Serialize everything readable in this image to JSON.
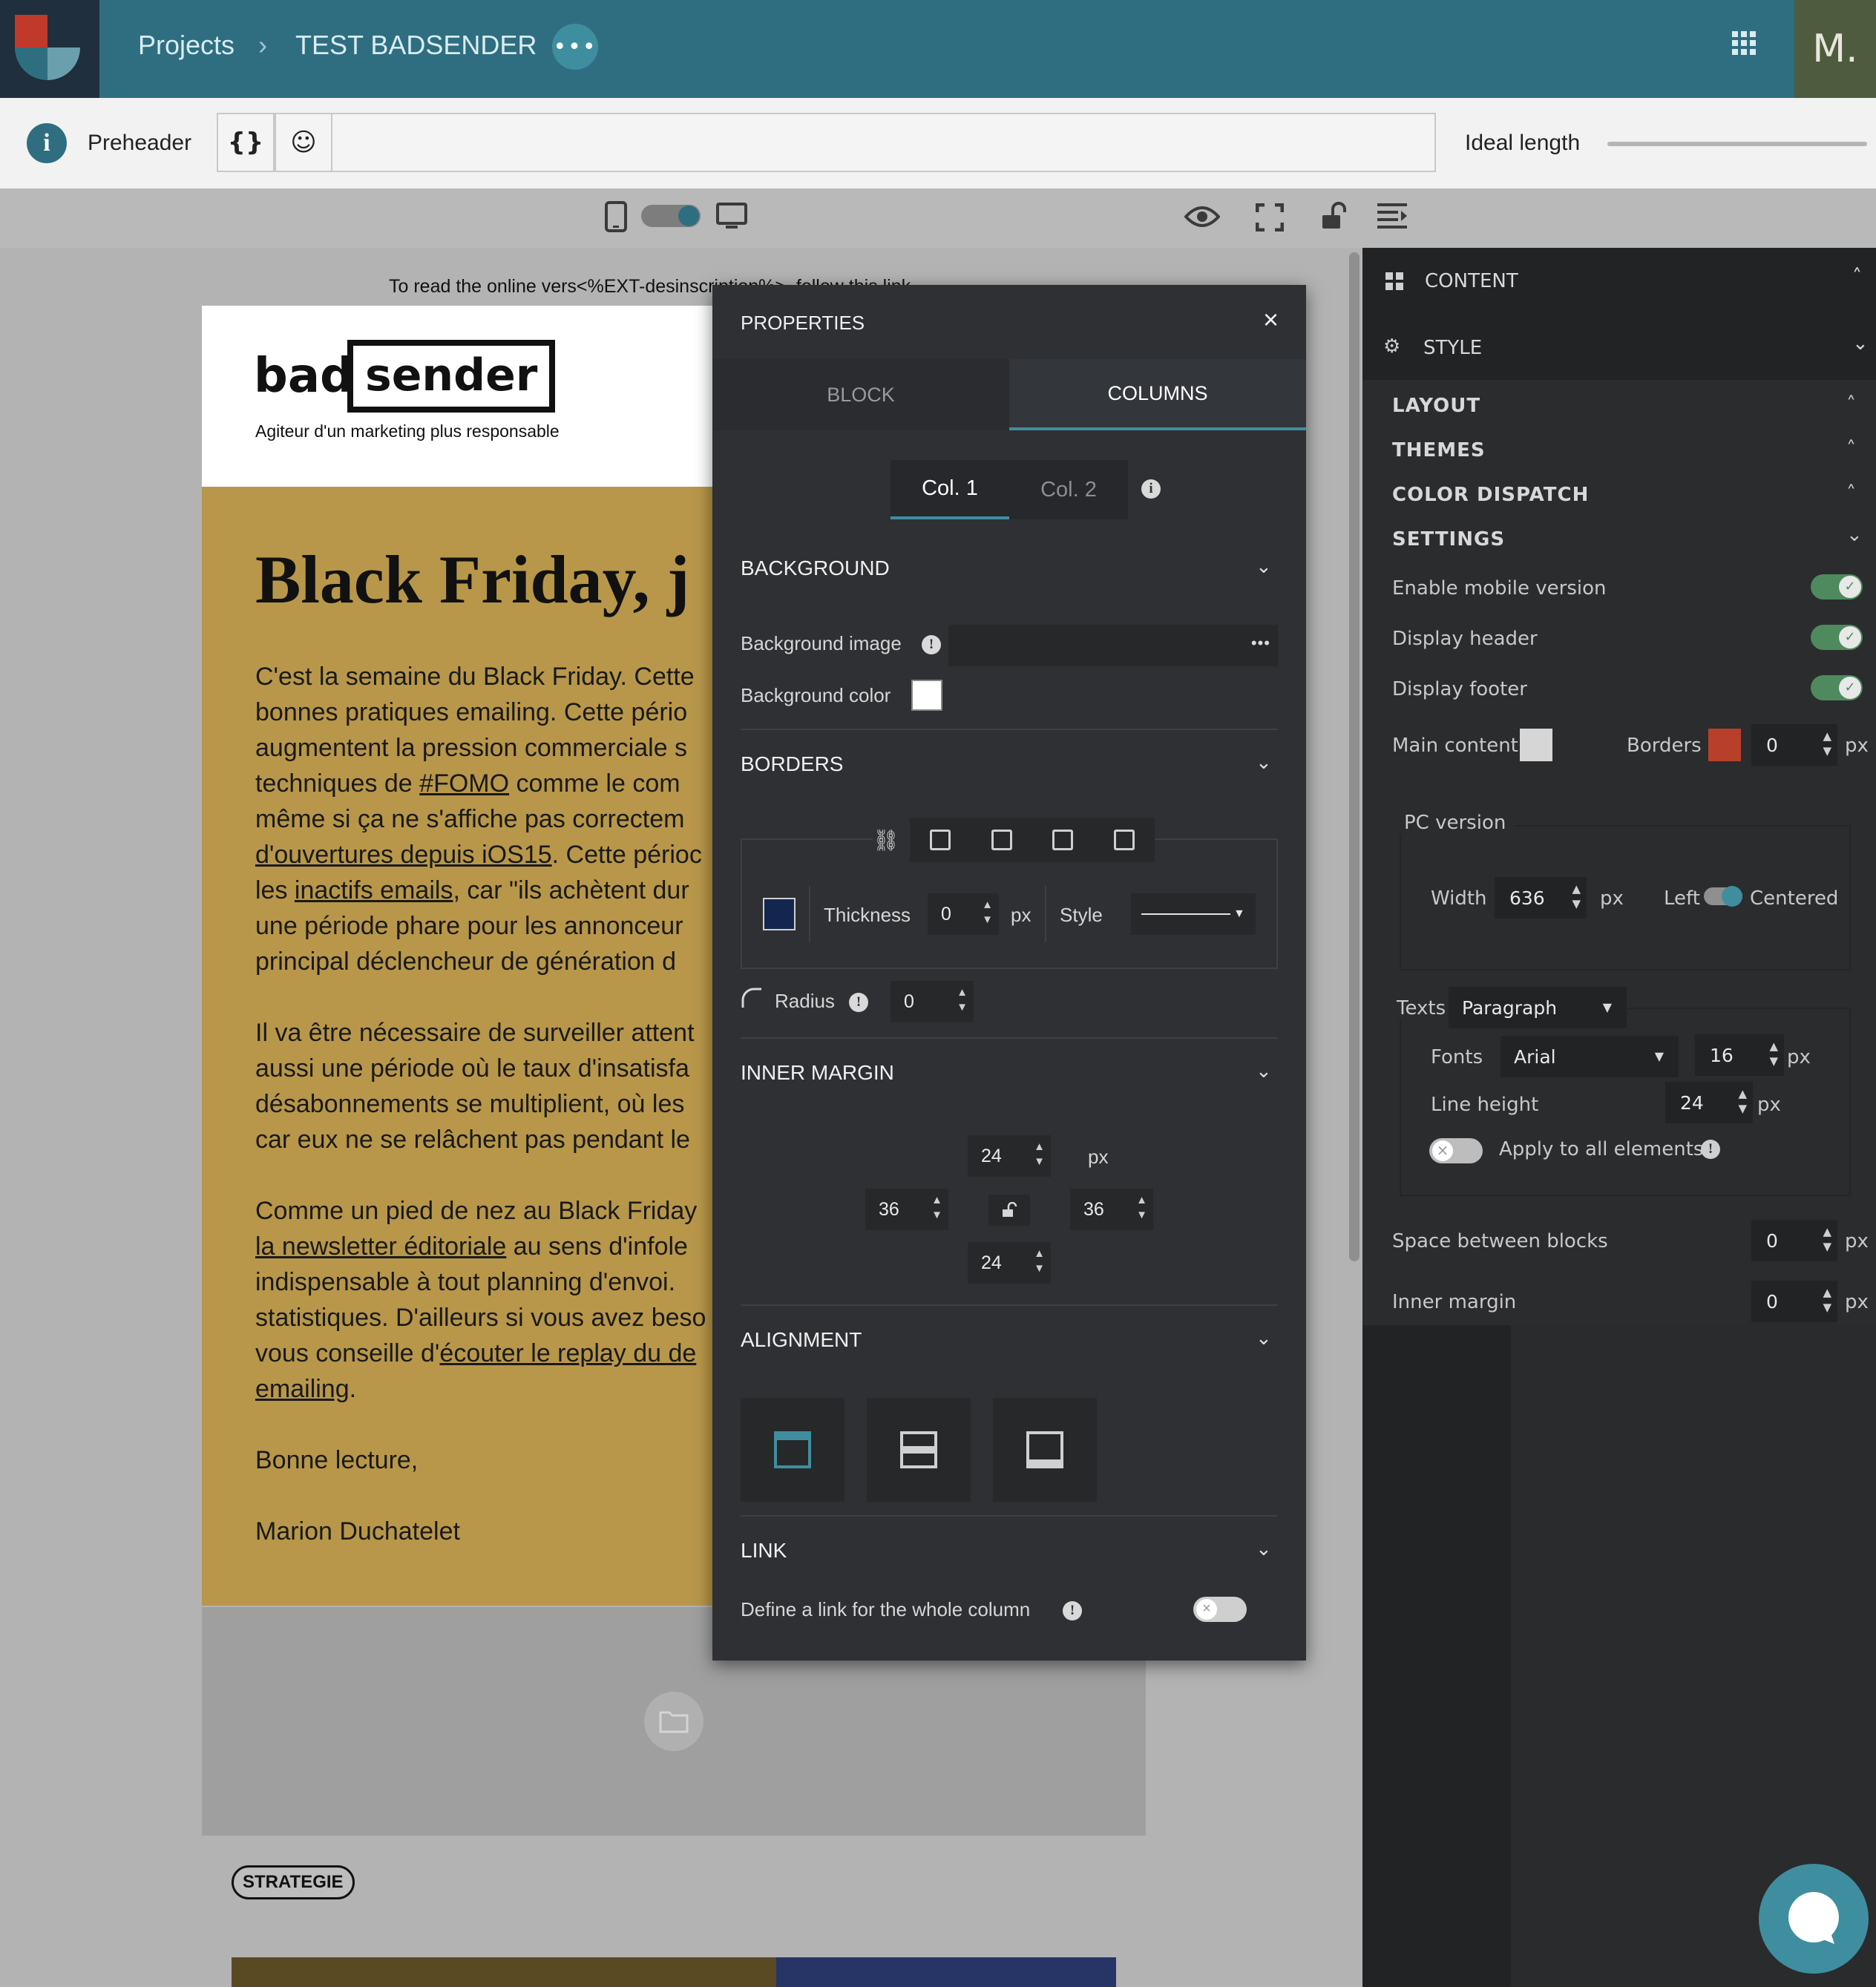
{
  "topbar": {
    "breadcrumb_projects": "Projects",
    "breadcrumb_sep": "›",
    "breadcrumb_project": "TEST BADSENDER",
    "more_label": "•••",
    "avatar": "M."
  },
  "preheader": {
    "info": "i",
    "label": "Preheader",
    "vars_button": "{}",
    "emoji_button": "☺",
    "input_value": "",
    "ideal_length_label": "Ideal length"
  },
  "email": {
    "online_text": "To read the online vers<%EXT-desinscription%>, follow this link",
    "brand_bad": "bad",
    "brand_sender": "sender",
    "tagline": "Agiteur d'un marketing plus responsable",
    "headline": "Black Friday, j",
    "p1": [
      "C'est la semaine du Black Friday. Cette",
      "bonnes pratiques emailing. Cette pério",
      "augmentent la pression commerciale s",
      "techniques de ",
      "#FOMO",
      " comme le com",
      "même si ça ne s'affiche pas correctem",
      "d'ouvertures depuis iOS15",
      ". Cette périoc",
      "les ",
      "inactifs emails",
      ", car \"ils achètent dur",
      "une période phare pour les annonceur",
      "principal déclencheur de génération d"
    ],
    "p2": [
      "Il va être nécessaire de surveiller attent",
      "aussi une période où le taux d'insatisfa",
      "désabonnements se multiplient, où les",
      "car eux ne se relâchent pas pendant le"
    ],
    "p3": [
      "Comme un pied de nez au Black Friday",
      "la newsletter éditoriale",
      " au sens d'infole",
      "indispensable à tout planning d'envoi.",
      "statistiques. D'ailleurs si vous avez beso",
      "vous conseille d'",
      "écouter le replay du de",
      "emailing",
      "."
    ],
    "closing": "Bonne lecture,",
    "signature": "Marion Duchatelet",
    "tag": "STRATEGIE"
  },
  "properties": {
    "title": "PROPERTIES",
    "close": "×",
    "tabs": [
      "BLOCK",
      "COLUMNS"
    ],
    "active_tab": "COLUMNS",
    "col_tabs": [
      "Col. 1",
      "Col. 2"
    ],
    "col_info": "i",
    "background": {
      "title": "BACKGROUND",
      "image_label": "Background image",
      "image_more": "•••",
      "color_label": "Background color"
    },
    "borders": {
      "title": "BORDERS",
      "thickness_label": "Thickness",
      "thickness_value": "0",
      "unit": "px",
      "style_label": "Style",
      "radius_label": "Radius",
      "radius_value": "0",
      "color": "#13264f"
    },
    "inner_margin": {
      "title": "INNER MARGIN",
      "top": "24",
      "left": "36",
      "right": "36",
      "bottom": "24",
      "unit": "px"
    },
    "alignment": {
      "title": "ALIGNMENT"
    },
    "link": {
      "title": "LINK",
      "label": "Define a link for the whole column"
    },
    "info_mark": "!"
  },
  "right_panel": {
    "content_label": "CONTENT",
    "style_label": "STYLE",
    "layout": "LAYOUT",
    "themes": "THEMES",
    "color_dispatch": "COLOR DISPATCH",
    "settings": "SETTINGS",
    "enable_mobile": "Enable mobile version",
    "display_header": "Display header",
    "display_footer": "Display footer",
    "main_content": "Main content",
    "borders": "Borders",
    "borders_value": "0",
    "borders_color": "#b8402a",
    "unit": "px",
    "pc_version": "PC version",
    "width_label": "Width",
    "width_value": "636",
    "left_label": "Left",
    "centered_label": "Centered",
    "texts_label": "Texts",
    "texts_value": "Paragraph",
    "fonts_label": "Fonts",
    "fonts_value": "Arial",
    "font_size": "16",
    "line_height_label": "Line height",
    "line_height_value": "24",
    "apply_all": "Apply to all elements",
    "space_between": "Space between blocks",
    "space_value": "0",
    "inner_margin": "Inner margin",
    "inner_value": "0"
  },
  "colors": {
    "accent": "#2f6e80",
    "panel": "#2e3033",
    "email_bg": "#b8974a"
  }
}
